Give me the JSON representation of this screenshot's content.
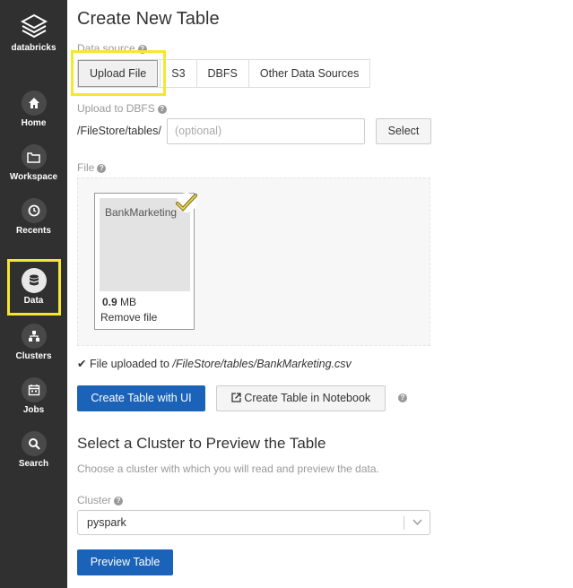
{
  "sidebar": {
    "brand": "databricks",
    "items": [
      {
        "label": "Home",
        "icon": "home-icon"
      },
      {
        "label": "Workspace",
        "icon": "folder-icon"
      },
      {
        "label": "Recents",
        "icon": "clock-icon"
      },
      {
        "label": "Data",
        "icon": "database-icon",
        "active": true
      },
      {
        "label": "Clusters",
        "icon": "cluster-icon"
      },
      {
        "label": "Jobs",
        "icon": "calendar-icon"
      },
      {
        "label": "Search",
        "icon": "search-icon"
      }
    ]
  },
  "page": {
    "title": "Create New Table"
  },
  "data_source": {
    "label": "Data source",
    "tabs": [
      "Upload File",
      "S3",
      "DBFS",
      "Other Data Sources"
    ],
    "active_tab": "Upload File"
  },
  "upload_to_dbfs": {
    "label": "Upload to DBFS",
    "prefix": "/FileStore/tables/",
    "placeholder": "(optional)",
    "select_label": "Select"
  },
  "file": {
    "label": "File",
    "name": "BankMarketing",
    "size_value": "0.9",
    "size_unit": "MB",
    "remove_label": "Remove file",
    "status_prefix": "File uploaded to ",
    "status_path": "/FileStore/tables/BankMarketing.csv"
  },
  "actions": {
    "create_ui": "Create Table with UI",
    "create_notebook": "Create Table in Notebook"
  },
  "cluster_section": {
    "heading": "Select a Cluster to Preview the Table",
    "description": "Choose a cluster with which you will read and preview the data.",
    "cluster_label": "Cluster",
    "cluster_value": "pyspark",
    "preview_button": "Preview Table"
  },
  "colors": {
    "primary": "#1a63b8",
    "sidebar": "#303030",
    "highlight": "#f5e631"
  }
}
